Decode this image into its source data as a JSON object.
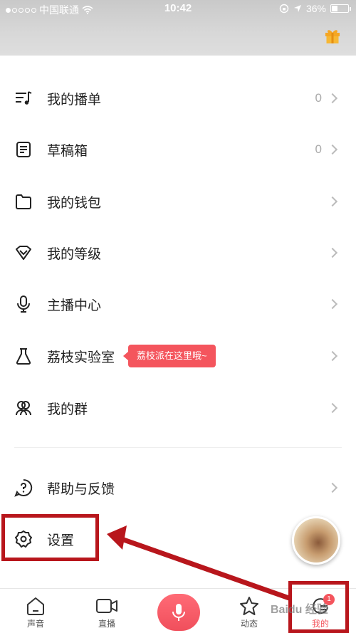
{
  "status_bar": {
    "carrier": "中国联通",
    "time": "10:42",
    "battery": "36%"
  },
  "menu": {
    "items": [
      {
        "label": "我的播单",
        "count": "0",
        "icon": "playlist-icon"
      },
      {
        "label": "草稿箱",
        "count": "0",
        "icon": "draft-icon"
      },
      {
        "label": "我的钱包",
        "count": "",
        "icon": "wallet-icon"
      },
      {
        "label": "我的等级",
        "count": "",
        "icon": "level-icon"
      },
      {
        "label": "主播中心",
        "count": "",
        "icon": "microphone-icon"
      },
      {
        "label": "荔枝实验室",
        "count": "",
        "icon": "flask-icon"
      },
      {
        "label": "我的群",
        "count": "",
        "icon": "group-icon"
      },
      {
        "label": "帮助与反馈",
        "count": "",
        "icon": "help-icon"
      },
      {
        "label": "设置",
        "count": "",
        "icon": "gear-icon"
      }
    ]
  },
  "tooltip": {
    "text": "荔枝派在这里哦~"
  },
  "tabbar": {
    "tabs": [
      {
        "label": "声音",
        "icon": "home-icon"
      },
      {
        "label": "直播",
        "icon": "video-icon"
      },
      {
        "label": "",
        "icon": "mic-icon"
      },
      {
        "label": "动态",
        "icon": "star-icon"
      },
      {
        "label": "我的",
        "icon": "profile-icon"
      }
    ],
    "badge": "1"
  },
  "watermark": "Baidu 经验",
  "colors": {
    "accent": "#f4555d",
    "annotation": "#b8161c"
  }
}
